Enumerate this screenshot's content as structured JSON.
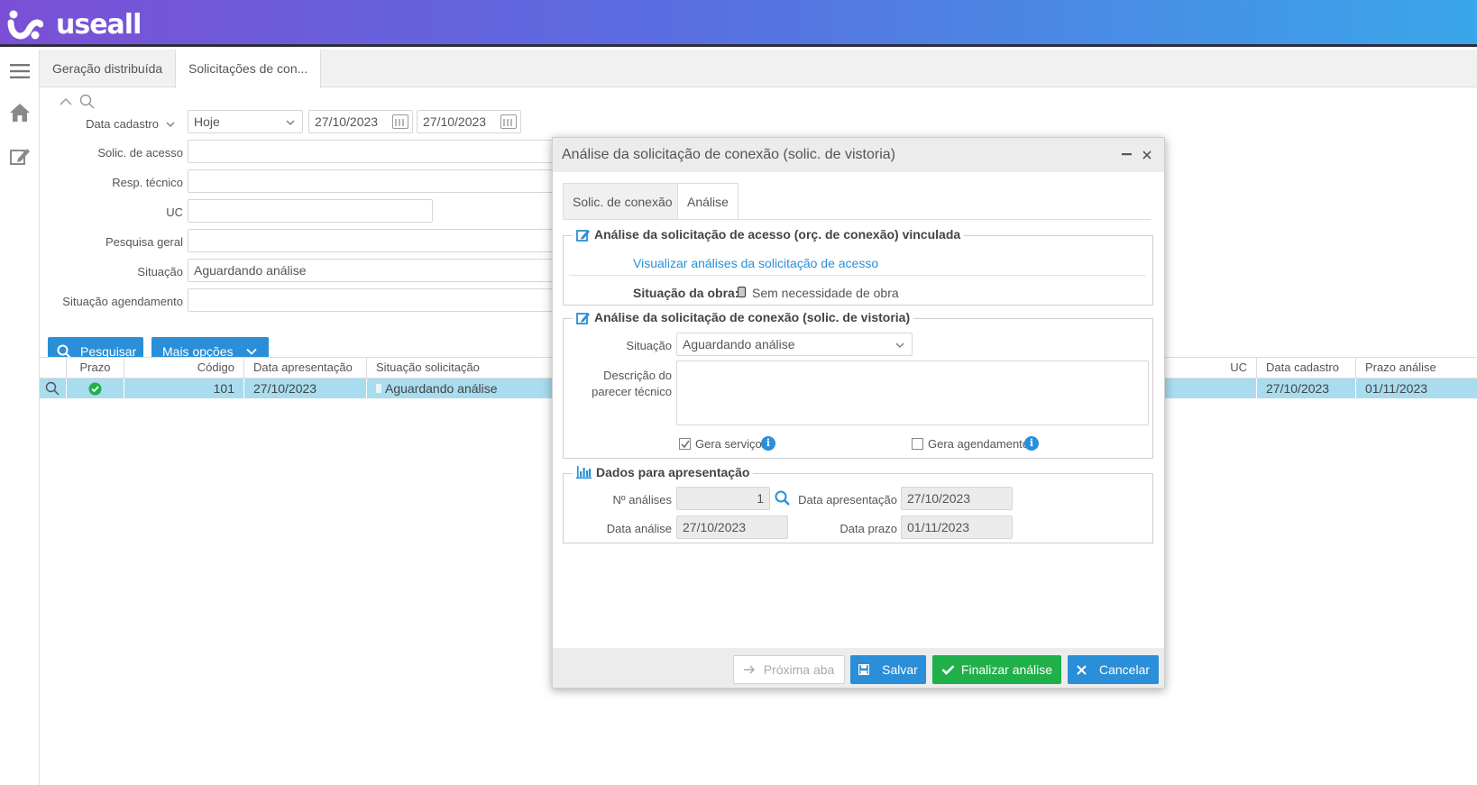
{
  "app": {
    "logo_text": "useall"
  },
  "tabs": [
    {
      "label": "Geração distribuída"
    },
    {
      "label": "Solicitações de con..."
    }
  ],
  "filters": {
    "data_cadastro": {
      "label": "Data cadastro",
      "period": "Hoje",
      "date_from": "27/10/2023",
      "date_to": "27/10/2023"
    },
    "solic_acesso": {
      "label": "Solic. de acesso",
      "value": ""
    },
    "resp_tecnico": {
      "label": "Resp. técnico",
      "value": ""
    },
    "uc": {
      "label": "UC",
      "value": ""
    },
    "pesquisa_geral": {
      "label": "Pesquisa geral",
      "value": ""
    },
    "situacao": {
      "label": "Situação",
      "value": "Aguardando análise"
    },
    "situacao_agendamento": {
      "label": "Situação agendamento",
      "value": ""
    }
  },
  "actions": {
    "pesquisar": "Pesquisar",
    "mais_opcoes": "Mais opções"
  },
  "grid": {
    "columns": [
      "Prazo",
      "Código",
      "Data apresentação",
      "Situação solicitação",
      "UC",
      "Data cadastro",
      "Prazo análise"
    ],
    "rows": [
      {
        "codigo": "101",
        "data_apresentacao": "27/10/2023",
        "situacao": "Aguardando análise",
        "uc": "",
        "data_cadastro": "27/10/2023",
        "prazo_analise": "01/11/2023"
      }
    ]
  },
  "modal": {
    "title": "Análise da solicitação de conexão (solic. de vistoria)",
    "tabs": [
      "Solic. de conexão",
      "Análise"
    ],
    "section1": {
      "legend": "Análise da solicitação de acesso (orç. de conexão) vinculada",
      "link": "Visualizar análises da solicitação de acesso",
      "obra_label": "Situação da obra:",
      "obra_value": "Sem necessidade de obra"
    },
    "section2": {
      "legend": "Análise da solicitação de conexão (solic. de vistoria)",
      "situacao_label": "Situação",
      "situacao_value": "Aguardando análise",
      "descricao_label_1": "Descrição do",
      "descricao_label_2": "parecer técnico",
      "descricao_value": "",
      "gera_servico": "Gera serviço",
      "gera_agendamento": "Gera agendamento"
    },
    "section3": {
      "legend": "Dados para apresentação",
      "n_analises_label": "Nº análises",
      "n_analises_value": "1",
      "data_apresentacao_label": "Data apresentação",
      "data_apresentacao_value": "27/10/2023",
      "data_analise_label": "Data análise",
      "data_analise_value": "27/10/2023",
      "data_prazo_label": "Data prazo",
      "data_prazo_value": "01/11/2023"
    },
    "footer": {
      "proxima": "Próxima aba",
      "salvar": "Salvar",
      "finalizar": "Finalizar análise",
      "cancelar": "Cancelar"
    }
  },
  "colors": {
    "primary": "#2a8fd8",
    "success": "#20b04a",
    "row_selected": "#a9dcef"
  }
}
